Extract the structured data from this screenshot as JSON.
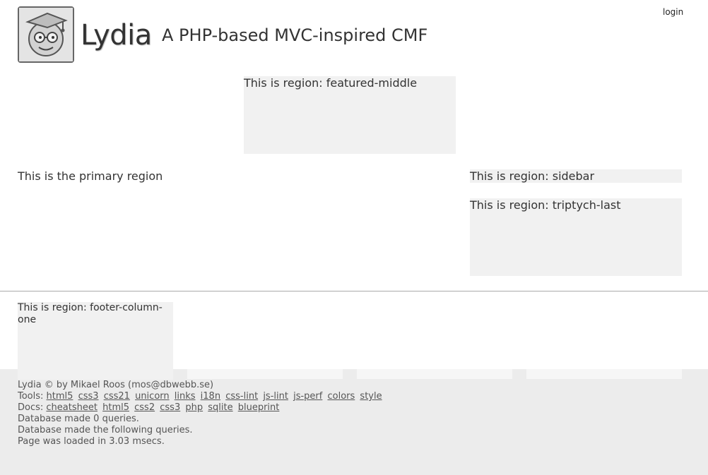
{
  "header": {
    "site_title": "Lydia",
    "site_slogan": "A PHP-based MVC-inspired CMF",
    "login_label": "login",
    "logo_icon": "lydia-logo-icon"
  },
  "regions": {
    "featured_middle": "This is region: featured-middle",
    "primary": "This is the primary region",
    "sidebar": "This is region: sidebar",
    "triptych_last": "This is region: triptych-last",
    "footer_column_one": "This is region: footer-column-one"
  },
  "footer": {
    "copyright": "Lydia © by Mikael Roos (mos@dbwebb.se)",
    "tools_label": "Tools:",
    "tools": [
      "html5",
      "css3",
      "css21",
      "unicorn",
      "links",
      "i18n",
      "css-lint",
      "js-lint",
      "js-perf",
      "colors",
      "style"
    ],
    "docs_label": "Docs:",
    "docs": [
      "cheatsheet",
      "html5",
      "css2",
      "css3",
      "php",
      "sqlite",
      "blueprint"
    ],
    "queries_count": "Database made 0 queries.",
    "queries_list": "Database made the following queries.",
    "load_time": "Page was loaded in 3.03 msecs."
  },
  "colors": {
    "region_bg": "#f1f1f1",
    "footer_bg": "#ececec",
    "text": "#333333"
  }
}
